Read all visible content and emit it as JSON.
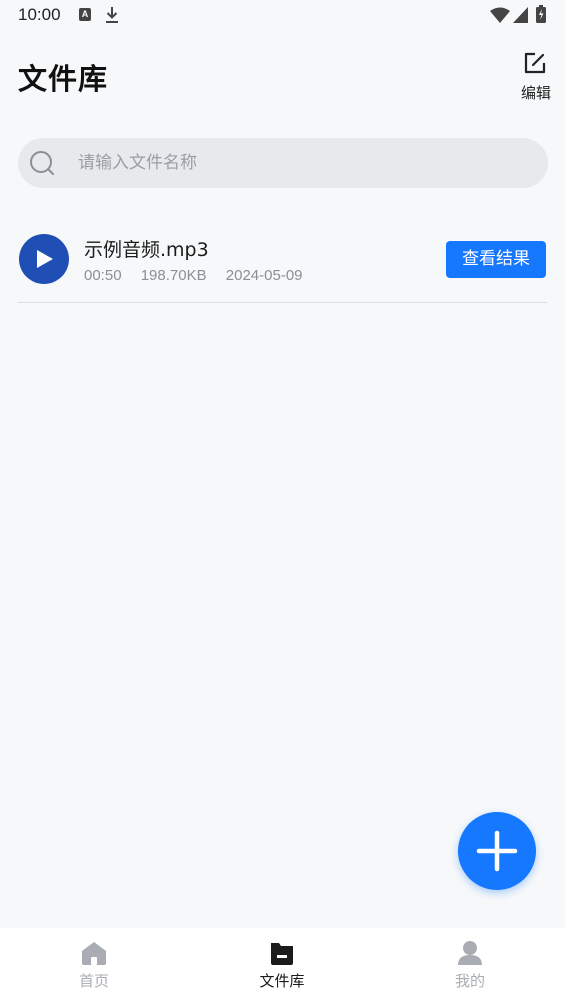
{
  "status_bar": {
    "time": "10:00",
    "notification_icons": [
      "a-icon",
      "download-icon"
    ],
    "system_icons": [
      "wifi-icon",
      "signal-icon",
      "battery-icon"
    ]
  },
  "header": {
    "title": "文件库",
    "edit_label": "编辑"
  },
  "search": {
    "placeholder": "请输入文件名称",
    "value": ""
  },
  "files": [
    {
      "name": "示例音频.mp3",
      "duration": "00:50",
      "size": "198.70KB",
      "date": "2024-05-09",
      "action_label": "查看结果"
    }
  ],
  "fab": {
    "icon": "plus-icon"
  },
  "bottom_nav": {
    "items": [
      {
        "label": "首页",
        "icon": "home-icon",
        "active": false
      },
      {
        "label": "文件库",
        "icon": "folder-icon",
        "active": true
      },
      {
        "label": "我的",
        "icon": "user-icon",
        "active": false
      }
    ]
  },
  "colors": {
    "accent": "#1677ff",
    "play_button": "#1f4fb5",
    "background": "#f6f8fa",
    "search_bg": "#e7e9ec",
    "inactive_nav": "#a9adb3"
  }
}
